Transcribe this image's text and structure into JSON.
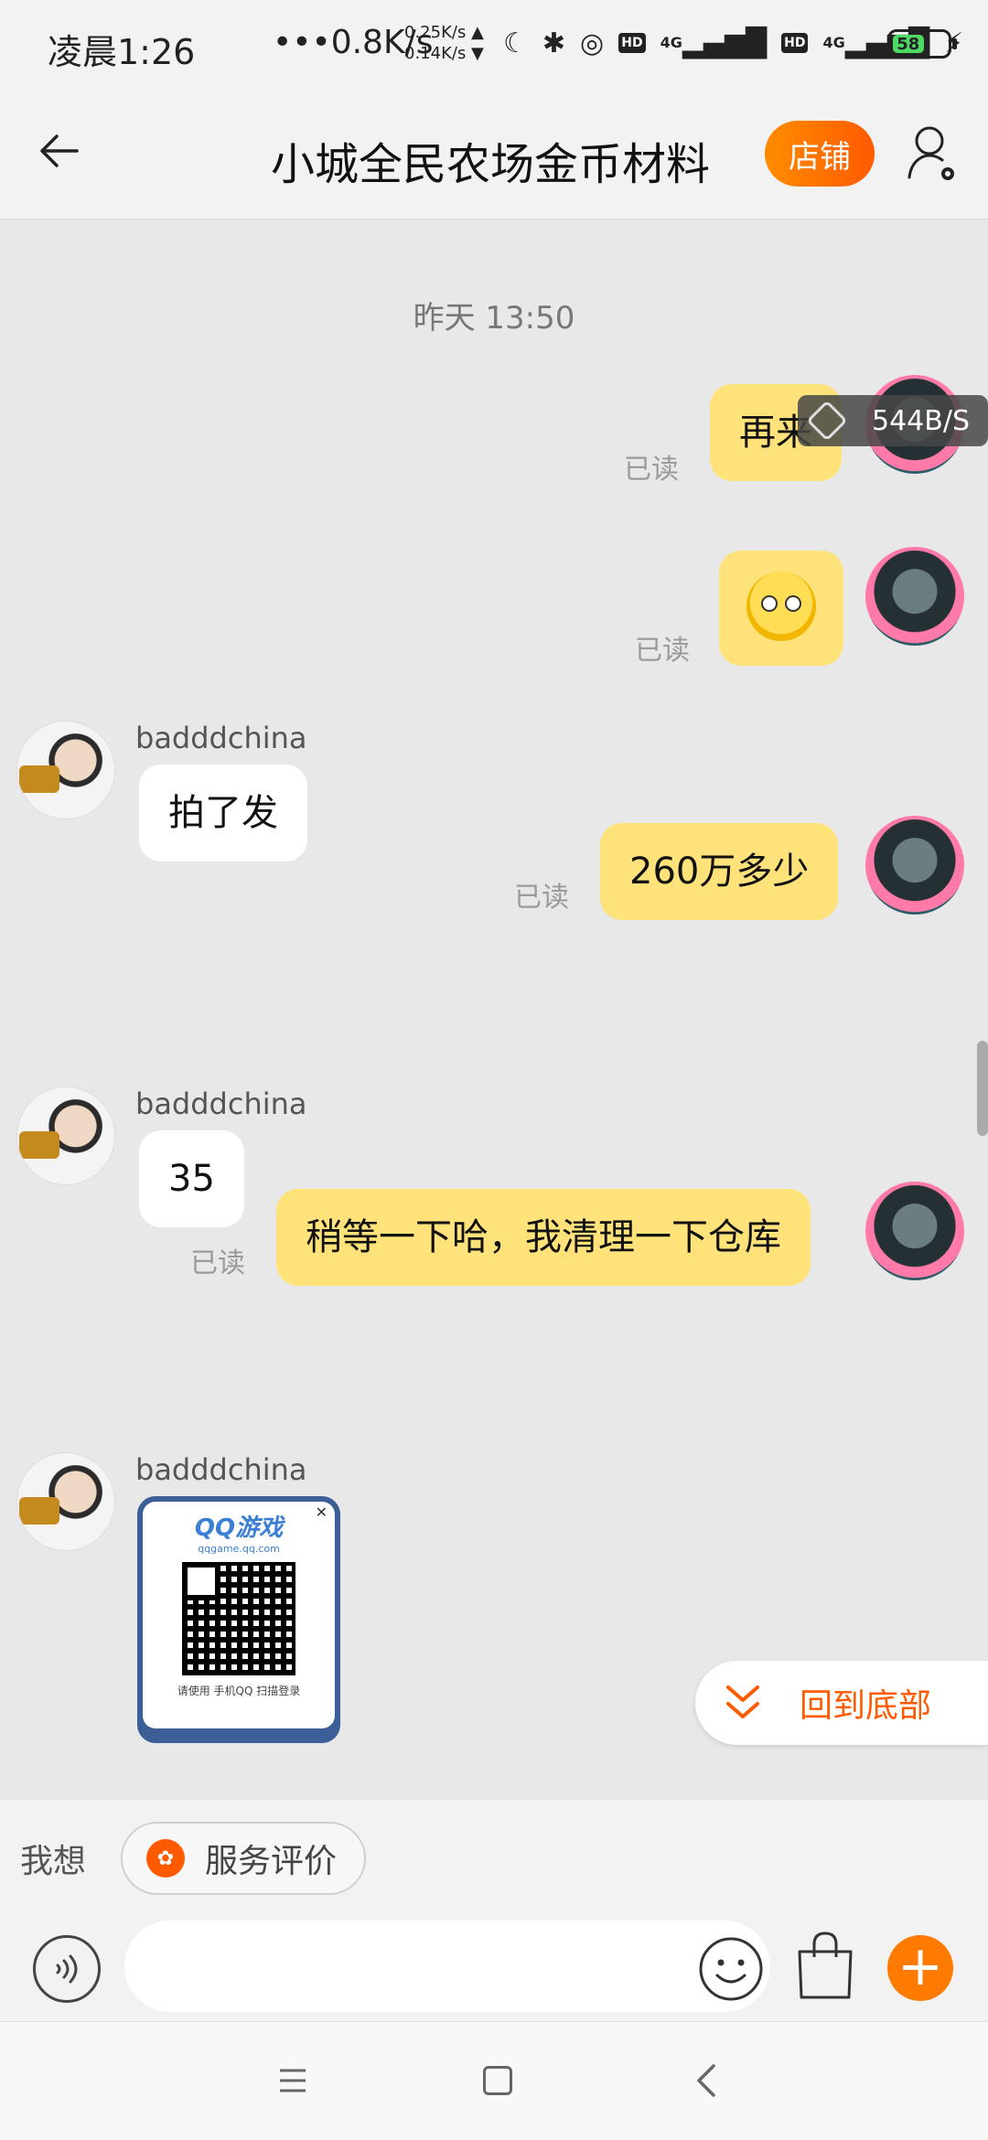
{
  "status_bar": {
    "time": "凌晨1:26",
    "speed": "•••0.8K/s",
    "up_speed": "0.25K/s ▲",
    "down_speed": "0.14K/s ▼",
    "network1": "4G",
    "network2": "4G",
    "hd1": "HD",
    "hd2": "HD",
    "battery": "58"
  },
  "header": {
    "title": "小城全民农场金币材料",
    "shop_label": "店铺"
  },
  "chat": {
    "timestamp": "昨天 13:50",
    "speed_overlay": "544B/S",
    "messages": [
      {
        "side": "me",
        "text": "再来",
        "read": "已读"
      },
      {
        "side": "me",
        "emoji": "face-with-rolling-eyes",
        "read": "已读"
      },
      {
        "side": "peer",
        "sender": "badddchina",
        "text": "拍了发"
      },
      {
        "side": "me",
        "text": "260万多少",
        "read": "已读"
      },
      {
        "side": "peer",
        "sender": "badddchina",
        "text": "35"
      },
      {
        "side": "me",
        "text": "稍等一下哈，我清理一下仓库",
        "read": "已读"
      },
      {
        "side": "peer",
        "sender": "badddchina",
        "qr_card": {
          "title": "QQ游戏",
          "url": "qqgame.qq.com",
          "caption": "请使用 手机QQ 扫描登录"
        }
      }
    ],
    "to_bottom_label": "回到底部"
  },
  "input": {
    "wish_label": "我想",
    "service_chip_label": "服务评价",
    "text_placeholder": ""
  },
  "colors": {
    "accent": "#ff5a00",
    "my_bubble": "#ffe27a",
    "peer_bubble": "#ffffff",
    "chat_bg": "#e8e8e8"
  }
}
